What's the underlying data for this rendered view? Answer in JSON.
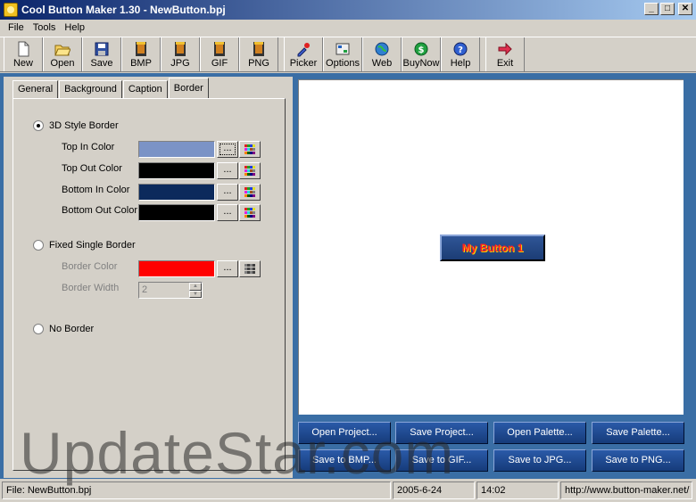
{
  "window": {
    "title": "Cool Button Maker 1.30 - NewButton.bpj",
    "min": "_",
    "max": "□",
    "close": "✕"
  },
  "menu": [
    "File",
    "Tools",
    "Help"
  ],
  "toolbar": [
    {
      "label": "New",
      "icon": "new-file-icon"
    },
    {
      "label": "Open",
      "icon": "open-folder-icon"
    },
    {
      "label": "Save",
      "icon": "save-disk-icon"
    },
    {
      "label": "BMP",
      "icon": "bmp-film-icon"
    },
    {
      "label": "JPG",
      "icon": "jpg-film-icon"
    },
    {
      "label": "GIF",
      "icon": "gif-film-icon"
    },
    {
      "label": "PNG",
      "icon": "png-film-icon"
    },
    {
      "label": "Picker",
      "icon": "eyedropper-icon"
    },
    {
      "label": "Options",
      "icon": "options-icon"
    },
    {
      "label": "Web",
      "icon": "globe-icon"
    },
    {
      "label": "BuyNow",
      "icon": "dollar-icon"
    },
    {
      "label": "Help",
      "icon": "help-icon"
    },
    {
      "label": "Exit",
      "icon": "exit-arrow-icon"
    }
  ],
  "tabs": [
    "General",
    "Background",
    "Caption",
    "Border"
  ],
  "active_tab": "Border",
  "border": {
    "style_3d_label": "3D Style Border",
    "top_in_label": "Top In Color",
    "top_in_color": "#7b93c6",
    "top_out_label": "Top Out Color",
    "top_out_color": "#000000",
    "bottom_in_label": "Bottom In Color",
    "bottom_in_color": "#0c2a5c",
    "bottom_out_label": "Bottom Out Color",
    "bottom_out_color": "#000000",
    "fixed_single_label": "Fixed Single Border",
    "border_color_label": "Border Color",
    "border_color": "#ff0000",
    "border_width_label": "Border Width",
    "border_width_value": "2",
    "no_border_label": "No Border",
    "dots": "..."
  },
  "preview": {
    "button_caption": "My Button 1"
  },
  "actions": {
    "open_project": "Open Project...",
    "save_project": "Save Project...",
    "open_palette": "Open Palette...",
    "save_palette": "Save Palette...",
    "save_bmp": "Save to BMP...",
    "save_gif": "Save to GIF...",
    "save_jpg": "Save to JPG...",
    "save_png": "Save to PNG..."
  },
  "watermark": "UpdateStar.com",
  "status": {
    "file": "File:  NewButton.bpj",
    "date": "2005-6-24",
    "time": "14:02",
    "url": "http://www.button-maker.net/"
  }
}
